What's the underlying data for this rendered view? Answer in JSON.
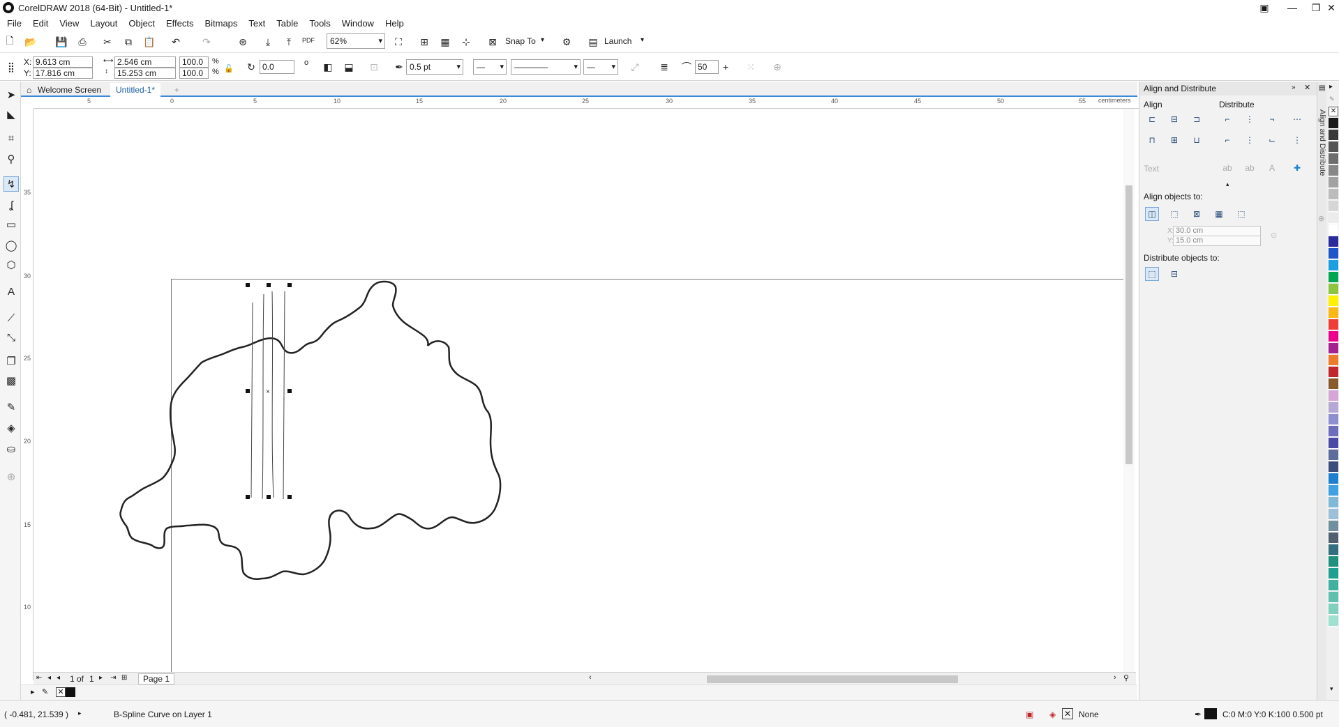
{
  "window": {
    "title": "CorelDRAW 2018 (64-Bit) - Untitled-1*"
  },
  "menu": [
    "File",
    "Edit",
    "View",
    "Layout",
    "Object",
    "Effects",
    "Bitmaps",
    "Text",
    "Table",
    "Tools",
    "Window",
    "Help"
  ],
  "standard_toolbar": {
    "zoom": "62%",
    "snap_to": "Snap To",
    "launch": "Launch",
    "pdf": "PDF"
  },
  "property_bar": {
    "x": "9.613 cm",
    "y": "17.816 cm",
    "width": "2.546 cm",
    "height": "15.253 cm",
    "scale_w": "100.0",
    "scale_h": "100.0",
    "percent": "%",
    "angle": "0.0",
    "degree": "o",
    "outline_width": "0.5 pt",
    "smoothing": "50"
  },
  "tabs": {
    "welcome": "Welcome Screen",
    "doc": "Untitled-1*"
  },
  "ruler": {
    "units": "centimeters",
    "h_ticks": [
      "5",
      "0",
      "5",
      "10",
      "15",
      "20",
      "25",
      "30",
      "35",
      "40",
      "45",
      "50",
      "55"
    ],
    "v_ticks": [
      "35",
      "30",
      "25",
      "20",
      "15",
      "10"
    ]
  },
  "page_nav": {
    "current": "1",
    "of": "of",
    "total": "1",
    "page_tab": "Page 1"
  },
  "status": {
    "coords": "( -0.481, 21.539 )",
    "object_info": "B-Spline Curve on Layer 1",
    "fill": "None",
    "outline": "C:0 M:0 Y:0 K:100  0.500 pt"
  },
  "docker": {
    "title": "Align and Distribute",
    "align_label": "Align",
    "distribute_label": "Distribute",
    "text_label": "Text",
    "align_objects_to": "Align objects to:",
    "x_label": "X:",
    "x_value": "30.0 cm",
    "y_label": "Y:",
    "y_value": "15.0 cm",
    "distribute_objects_to": "Distribute objects to:",
    "tab_label": "Align and Distribute"
  },
  "palette": [
    "#1a1a1a",
    "#3a3a3a",
    "#555555",
    "#6e6e6e",
    "#888888",
    "#a2a2a2",
    "#bcbcbc",
    "#d6d6d6",
    "#ececec",
    "#ffffff",
    "#2b2b9b",
    "#1f57c8",
    "#1aa0e0",
    "#00a651",
    "#8cc63f",
    "#fff200",
    "#fdb913",
    "#ef3e36",
    "#ec008c",
    "#a4238e",
    "#ee7b29",
    "#c1272d",
    "#8b5a2b",
    "#d6a6d6",
    "#b7a7d7",
    "#8f8fcf",
    "#6d6dbd",
    "#4b4ba5",
    "#5c6c9c",
    "#3c4c7c",
    "#2080d0",
    "#40a0e0",
    "#80b8d8",
    "#9cc0d8",
    "#7090a0",
    "#506070",
    "#307080",
    "#209080",
    "#20a090",
    "#40b0a0",
    "#60c0b0",
    "#80d0c0",
    "#a0e0d0"
  ]
}
